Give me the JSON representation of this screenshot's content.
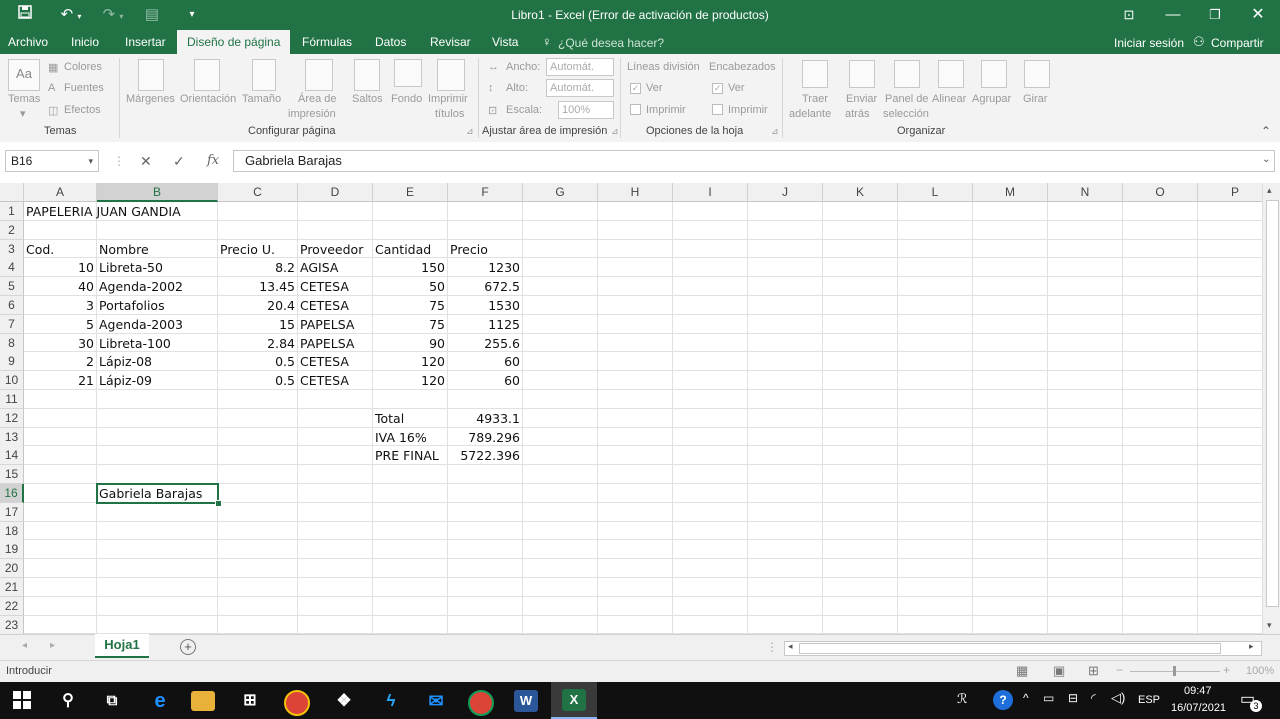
{
  "window": {
    "title": "Libro1 - Excel (Error de activación de productos)",
    "undo_icon": "undo-icon",
    "redo_icon": "redo-icon",
    "save_icon": "save-icon"
  },
  "menu": {
    "tabs": [
      "Archivo",
      "Inicio",
      "Insertar",
      "Diseño de página",
      "Fórmulas",
      "Datos",
      "Revisar",
      "Vista"
    ],
    "active": "Diseño de página",
    "tell_me": "¿Qué desea hacer?",
    "sign_in": "Iniciar sesión",
    "share": "Compartir"
  },
  "ribbon": {
    "temas": {
      "temas": "Temas",
      "colores": "Colores",
      "fuentes": "Fuentes",
      "efectos": "Efectos",
      "group": "Temas"
    },
    "configurar": {
      "margenes": "Márgenes",
      "orientacion": "Orientación",
      "tamano": "Tamaño",
      "area1": "Área de",
      "area2": "impresión",
      "saltos": "Saltos",
      "fondo": "Fondo",
      "imprimir1": "Imprimir",
      "imprimir2": "títulos",
      "group": "Configurar página"
    },
    "ajustar": {
      "ancho": "Ancho:",
      "ancho_val": "Automát.",
      "alto": "Alto:",
      "alto_val": "Automát.",
      "escala": "Escala:",
      "escala_val": "100%",
      "group": "Ajustar área de impresión"
    },
    "opciones": {
      "lineas": "Líneas división",
      "encabezados": "Encabezados",
      "ver1": "Ver",
      "ver2": "Ver",
      "imprimir1": "Imprimir",
      "imprimir2": "Imprimir",
      "group": "Opciones de la hoja"
    },
    "organizar": {
      "traer1": "Traer",
      "traer2": "adelante",
      "enviar1": "Enviar",
      "enviar2": "atrás",
      "panel1": "Panel de",
      "panel2": "selección",
      "alinear": "Alinear",
      "agrupar": "Agrupar",
      "girar": "Girar",
      "group": "Organizar"
    }
  },
  "formula_bar": {
    "name_box": "B16",
    "fx": "fx",
    "content": "Gabriela Barajas"
  },
  "columns": [
    "A",
    "B",
    "C",
    "D",
    "E",
    "F",
    "G",
    "H",
    "I",
    "J",
    "K",
    "L",
    "M",
    "N",
    "O",
    "P"
  ],
  "rows": [
    "1",
    "2",
    "3",
    "4",
    "5",
    "6",
    "7",
    "8",
    "9",
    "10",
    "11",
    "12",
    "13",
    "14",
    "15",
    "16",
    "17",
    "18",
    "19",
    "20",
    "21",
    "22",
    "23"
  ],
  "cells": {
    "r1": {
      "A": "PAPELERIA JUAN GANDIA"
    },
    "r3": {
      "A": "Cod.",
      "B": "Nombre",
      "C": "Precio U.",
      "D": "Proveedor",
      "E": "Cantidad",
      "F": "Precio"
    },
    "r4": {
      "A": "10",
      "B": "Libreta-50",
      "C": "8.2",
      "D": "AGISA",
      "E": "150",
      "F": "1230"
    },
    "r5": {
      "A": "40",
      "B": "Agenda-2002",
      "C": "13.45",
      "D": "CETESA",
      "E": "50",
      "F": "672.5"
    },
    "r6": {
      "A": "3",
      "B": "Portafolios",
      "C": "20.4",
      "D": "CETESA",
      "E": "75",
      "F": "1530"
    },
    "r7": {
      "A": "5",
      "B": "Agenda-2003",
      "C": "15",
      "D": "PAPELSA",
      "E": "75",
      "F": "1125"
    },
    "r8": {
      "A": "30",
      "B": "Libreta-100",
      "C": "2.84",
      "D": "PAPELSA",
      "E": "90",
      "F": "255.6"
    },
    "r9": {
      "A": "2",
      "B": "Lápiz-08",
      "C": "0.5",
      "D": "CETESA",
      "E": "120",
      "F": "60"
    },
    "r10": {
      "A": "21",
      "B": "Lápiz-09",
      "C": "0.5",
      "D": "CETESA",
      "E": "120",
      "F": "60"
    },
    "r12": {
      "E": "Total",
      "F": "4933.1"
    },
    "r13": {
      "E": "IVA 16%",
      "F": "789.296"
    },
    "r14": {
      "E": "PRE FINAL",
      "F": "5722.396"
    },
    "r16": {
      "B": "Gabriela Barajas"
    }
  },
  "sheet": {
    "tab": "Hoja1",
    "add": "+"
  },
  "status": {
    "mode": "Introducir",
    "zoom": "100%"
  },
  "taskbar": {
    "lang": "ESP",
    "time": "09:47",
    "date": "16/07/2021",
    "notif": "3"
  }
}
